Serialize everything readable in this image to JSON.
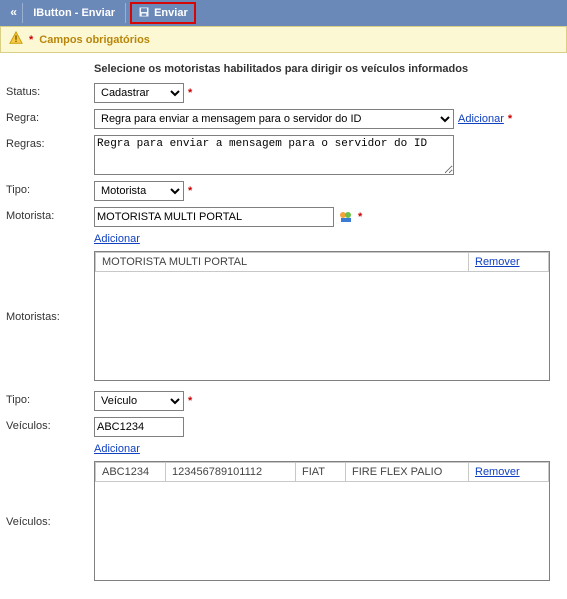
{
  "toolbar": {
    "back_glyph": "«",
    "title": "IButton - Enviar",
    "send_label": "Enviar"
  },
  "warning": {
    "asterisk": "*",
    "text": "Campos obrigatórios"
  },
  "instruction": "Selecione os motoristas habilitados para dirigir os veículos informados",
  "status": {
    "label": "Status:",
    "value": "Cadastrar"
  },
  "regra": {
    "label": "Regra:",
    "value": "Regra para enviar a mensagem para o servidor do ID",
    "add_link": "Adicionar"
  },
  "regras": {
    "label": "Regras:",
    "value": "Regra para enviar a mensagem para o servidor do ID"
  },
  "tipo1": {
    "label": "Tipo:",
    "value": "Motorista"
  },
  "motorista": {
    "label": "Motorista:",
    "value": "MOTORISTA MULTI PORTAL",
    "add_link": "Adicionar"
  },
  "motoristas_list": {
    "label": "Motoristas:",
    "rows": [
      {
        "name": "MOTORISTA MULTI PORTAL",
        "action": "Remover"
      }
    ]
  },
  "tipo2": {
    "label": "Tipo:",
    "value": "Veículo"
  },
  "veiculos_input": {
    "label": "Veículos:",
    "value": "ABC1234",
    "add_link": "Adicionar"
  },
  "veiculos_list": {
    "label": "Veículos:",
    "rows": [
      {
        "c1": "ABC1234",
        "c2": "123456789101112",
        "c3": "FIAT",
        "c4": "FIRE FLEX PALIO",
        "action": "Remover"
      }
    ]
  }
}
